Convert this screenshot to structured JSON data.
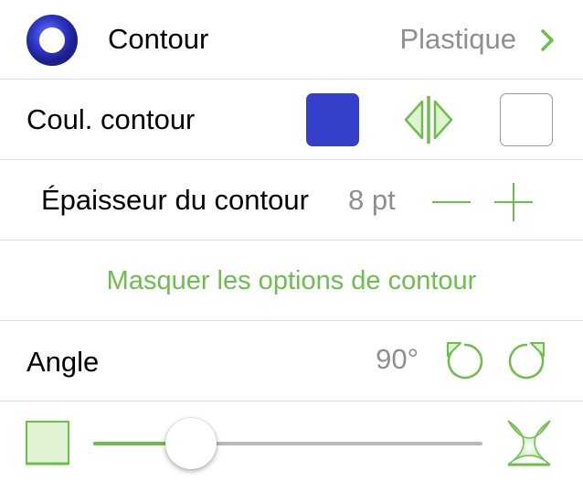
{
  "contour_row": {
    "title": "Contour",
    "style_value": "Plastique",
    "chevron_icon": "chevron-right-icon",
    "preview_icon": "ring-icon"
  },
  "color_row": {
    "label": "Coul. contour",
    "stroke_color": "#3440c9",
    "swap_icon": "swap-colors-icon",
    "fill_color": "#ffffff"
  },
  "thickness_row": {
    "label": "Épaisseur du contour",
    "value": "8 pt",
    "decrease_icon": "minus-icon",
    "increase_icon": "plus-icon"
  },
  "options_row": {
    "label": "Masquer les options de contour"
  },
  "angle_row": {
    "label": "Angle",
    "value": "90°",
    "rotate_left_icon": "rotate-ccw-icon",
    "rotate_right_icon": "rotate-cw-icon"
  },
  "shape_row": {
    "slider_value": 0.25,
    "min_icon": "square-corner-icon",
    "max_icon": "star-corner-icon"
  },
  "colors": {
    "accent": "#6cbf4a",
    "separator": "#dcdcdc",
    "secondary_text": "#8e8e93"
  }
}
